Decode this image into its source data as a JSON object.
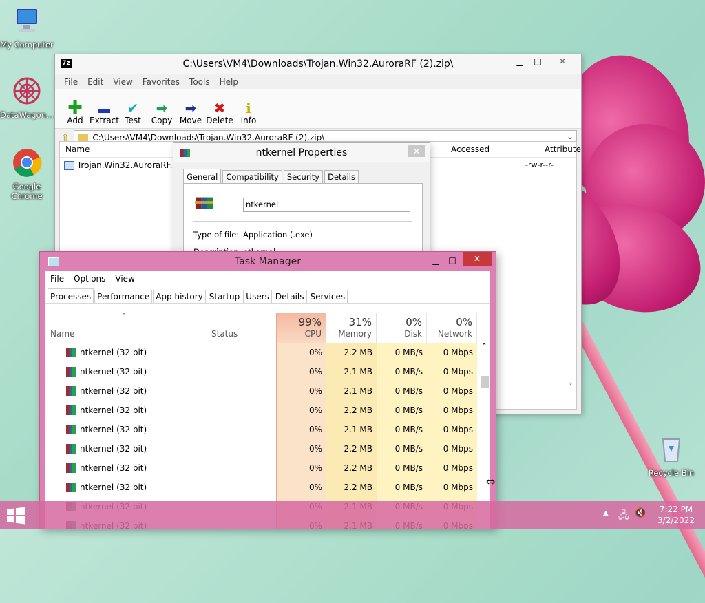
{
  "desktop": {
    "icons": [
      {
        "label": "My Computer"
      },
      {
        "label": "DataWagon..."
      },
      {
        "label": "Google Chrome"
      },
      {
        "label": "Recycle Bin"
      }
    ]
  },
  "zip_window": {
    "title": "C:\\Users\\VM4\\Downloads\\Trojan.Win32.AuroraRF (2).zip\\",
    "app_icon": "7z",
    "menu": [
      "File",
      "Edit",
      "View",
      "Favorites",
      "Tools",
      "Help"
    ],
    "toolbar": [
      {
        "label": "Add",
        "icon": "plus-icon",
        "color": "#1aa11a"
      },
      {
        "label": "Extract",
        "icon": "minus-icon",
        "color": "#1b37b6"
      },
      {
        "label": "Test",
        "icon": "check-icon",
        "color": "#14a7c0"
      },
      {
        "label": "Copy",
        "icon": "double-arrow-icon",
        "color": "#1aa05a"
      },
      {
        "label": "Move",
        "icon": "arrow-right-icon",
        "color": "#1c2f9a"
      },
      {
        "label": "Delete",
        "icon": "x-icon",
        "color": "#d41818"
      },
      {
        "label": "Info",
        "icon": "info-icon",
        "color": "#c9b400"
      }
    ],
    "address": "C:\\Users\\VM4\\Downloads\\Trojan.Win32.AuroraRF (2).zip\\",
    "columns": [
      "Name",
      "Accessed",
      "Attribute"
    ],
    "files": [
      {
        "name": "Trojan.Win32.AuroraRF....",
        "attributes": "-rw-r--r-"
      }
    ]
  },
  "props_window": {
    "title": "ntkernel Properties",
    "tabs": [
      "General",
      "Compatibility",
      "Security",
      "Details"
    ],
    "active_tab": "General",
    "filename": "ntkernel",
    "type_label": "Type of file:",
    "type_value": "Application (.exe)",
    "desc_label": "Description:",
    "desc_value": "ntkernel"
  },
  "task_manager": {
    "title": "Task Manager",
    "menu": [
      "File",
      "Options",
      "View"
    ],
    "tabs": [
      "Processes",
      "Performance",
      "App history",
      "Startup",
      "Users",
      "Details",
      "Services"
    ],
    "active_tab": "Processes",
    "headers": {
      "name": "Name",
      "status": "Status",
      "cpu_pct": "99%",
      "cpu": "CPU",
      "mem_pct": "31%",
      "mem": "Memory",
      "disk_pct": "0%",
      "disk": "Disk",
      "net_pct": "0%",
      "net": "Network"
    },
    "rows": [
      {
        "name": "ntkernel (32 bit)",
        "cpu": "0%",
        "mem": "2.2 MB",
        "disk": "0 MB/s",
        "net": "0 Mbps"
      },
      {
        "name": "ntkernel (32 bit)",
        "cpu": "0%",
        "mem": "2.1 MB",
        "disk": "0 MB/s",
        "net": "0 Mbps"
      },
      {
        "name": "ntkernel (32 bit)",
        "cpu": "0%",
        "mem": "2.1 MB",
        "disk": "0 MB/s",
        "net": "0 Mbps"
      },
      {
        "name": "ntkernel (32 bit)",
        "cpu": "0%",
        "mem": "2.2 MB",
        "disk": "0 MB/s",
        "net": "0 Mbps"
      },
      {
        "name": "ntkernel (32 bit)",
        "cpu": "0%",
        "mem": "2.1 MB",
        "disk": "0 MB/s",
        "net": "0 Mbps"
      },
      {
        "name": "ntkernel (32 bit)",
        "cpu": "0%",
        "mem": "2.2 MB",
        "disk": "0 MB/s",
        "net": "0 Mbps"
      },
      {
        "name": "ntkernel (32 bit)",
        "cpu": "0%",
        "mem": "2.2 MB",
        "disk": "0 MB/s",
        "net": "0 Mbps"
      },
      {
        "name": "ntkernel (32 bit)",
        "cpu": "0%",
        "mem": "2.2 MB",
        "disk": "0 MB/s",
        "net": "0 Mbps"
      },
      {
        "name": "ntkernel (32 bit)",
        "cpu": "0%",
        "mem": "2.1 MB",
        "disk": "0 MB/s",
        "net": "0 Mbps"
      },
      {
        "name": "ntkernel (32 bit)",
        "cpu": "0%",
        "mem": "2.1 MB",
        "disk": "0 MB/s",
        "net": "0 Mbps"
      }
    ]
  },
  "taskbar": {
    "time": "7:22 PM",
    "date": "3/2/2022"
  },
  "colors": {
    "taskmanager_frame": "#dd80b4",
    "cpu_column": "#f9d5b8",
    "cpu_header": "#f3b8a0",
    "column_highlight": "#fff4c4"
  }
}
